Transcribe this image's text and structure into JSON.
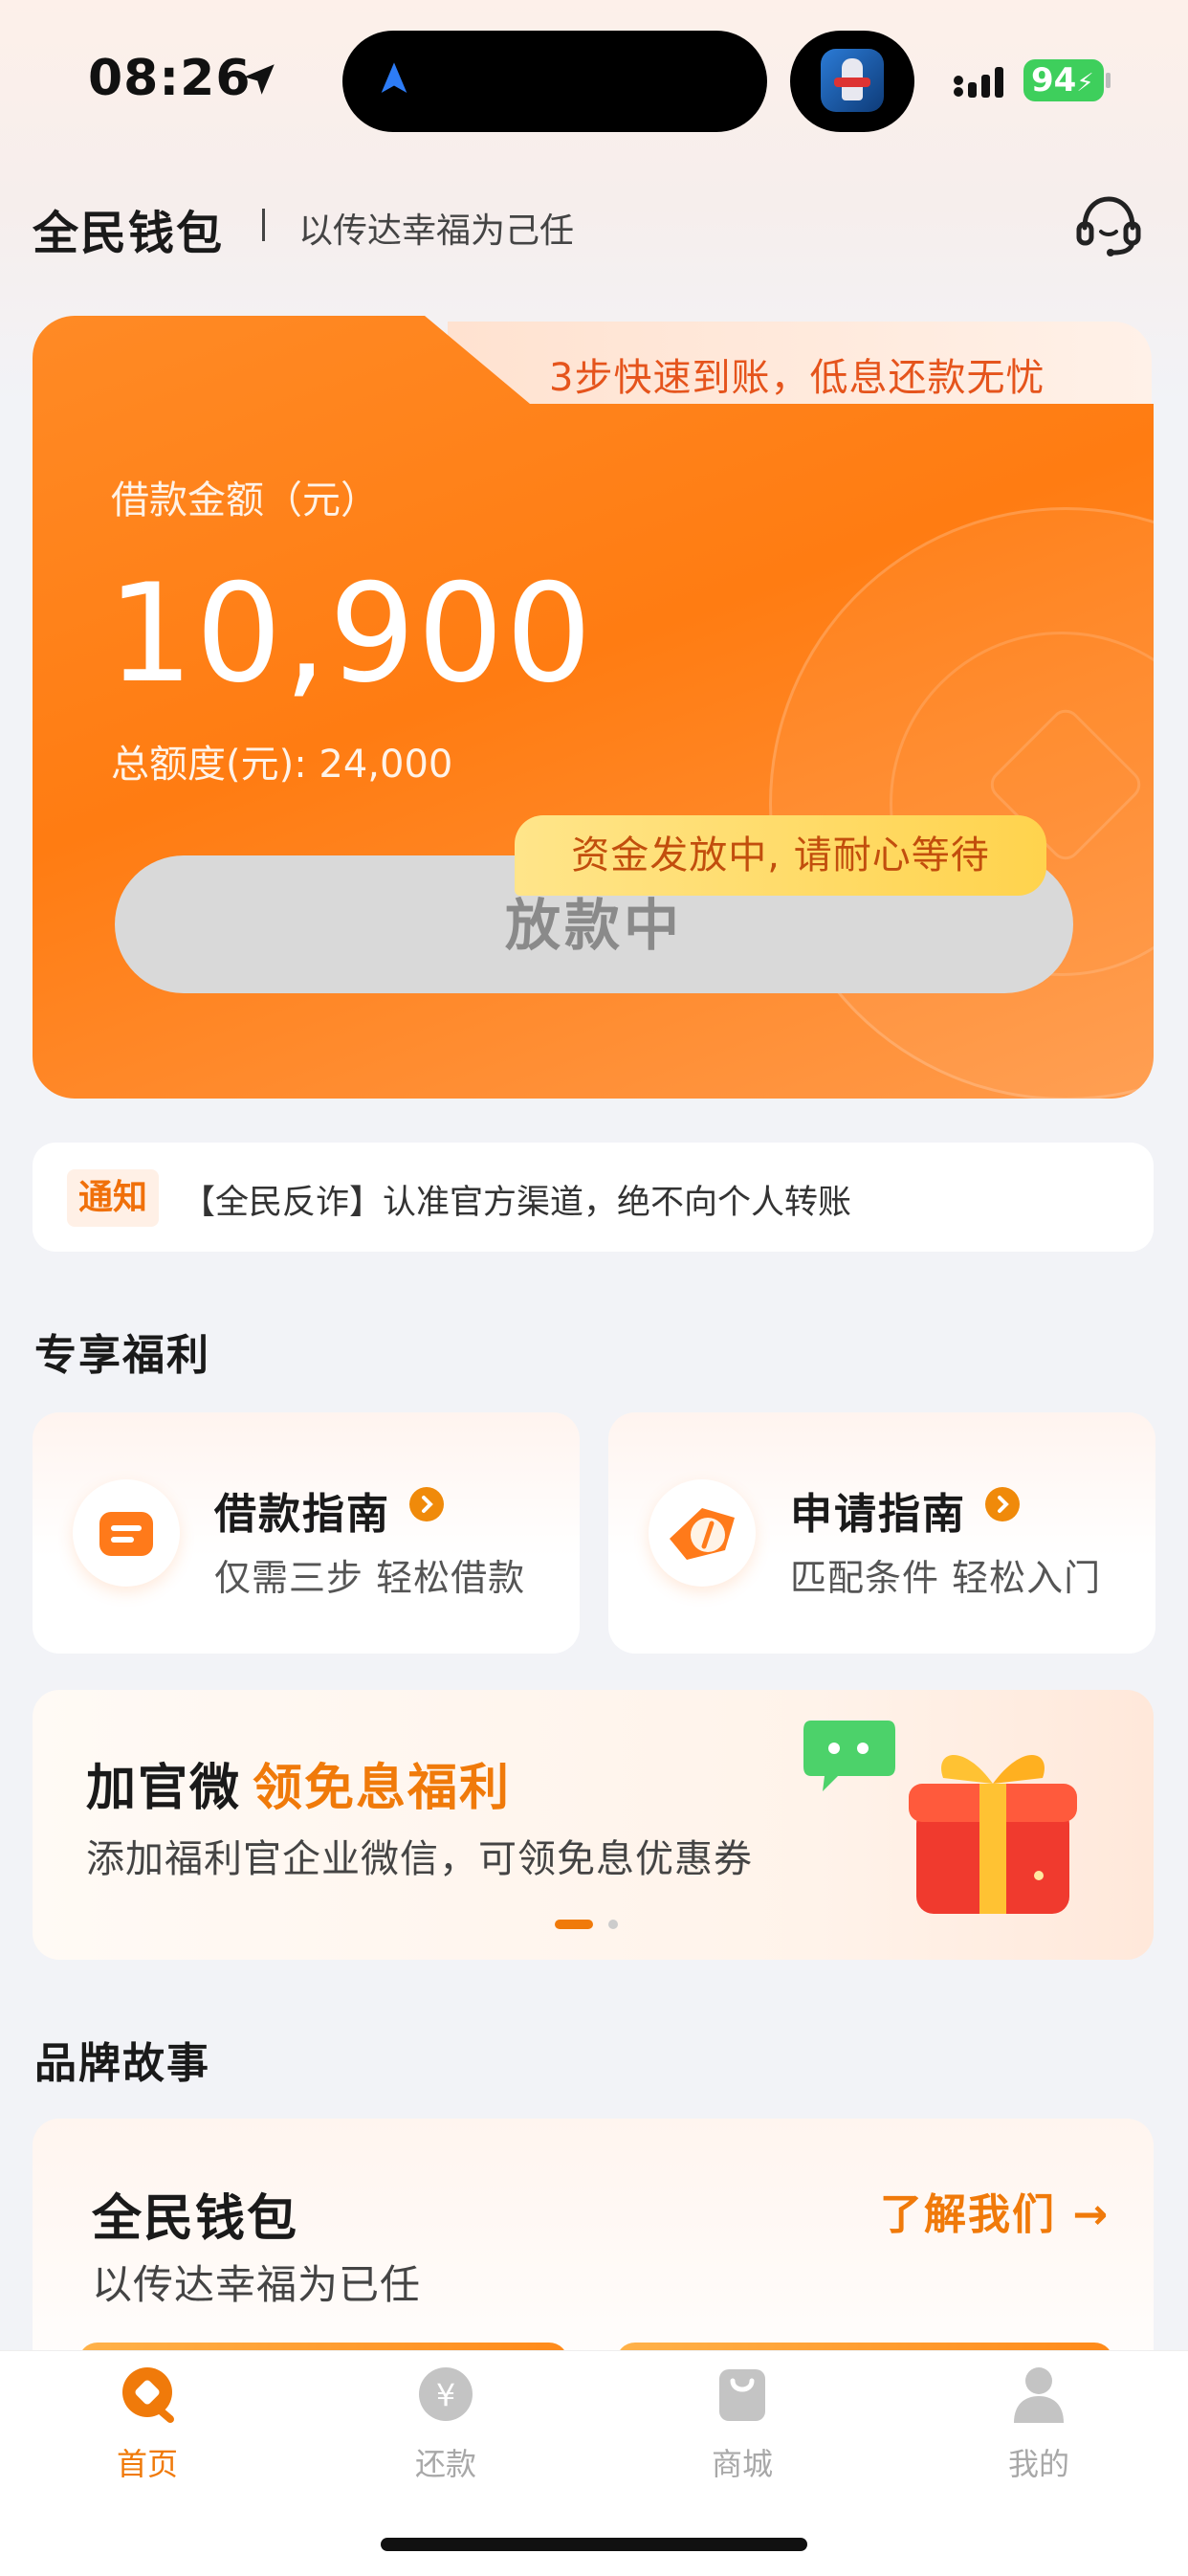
{
  "status_bar": {
    "time": "08:26",
    "battery": "94",
    "icons": [
      "location-arrow-icon",
      "navigation-icon",
      "app-activity-icon",
      "signal-icon",
      "battery-icon"
    ]
  },
  "header": {
    "brand": "全民钱包",
    "slogan": "以传达幸福为己任",
    "support_icon": "headset-icon"
  },
  "loan_card": {
    "tab_text": "3步快速到账，低息还款无忧",
    "amount_label": "借款金额（元）",
    "amount": "10,900",
    "total_quota": "总额度(元): 24,000",
    "button_label": "放款中",
    "tooltip": "资金发放中, 请耐心等待"
  },
  "notice": {
    "tag": "通知",
    "text": "【全民反诈】认准官方渠道，绝不向个人转账"
  },
  "benefits": {
    "title": "专享福利",
    "items": [
      {
        "title": "借款指南",
        "subtitle": "仅需三步 轻松借款",
        "icon": "loan-guide-icon"
      },
      {
        "title": "申请指南",
        "subtitle": "匹配条件 轻松入门",
        "icon": "compass-icon"
      }
    ]
  },
  "banner": {
    "title_black": "加官微",
    "title_orange": "领免息福利",
    "subtitle": "添加福利官企业微信，可领免息优惠券",
    "icons": [
      "wechat-chat-icon",
      "gift-box-icon"
    ]
  },
  "brand_story": {
    "section_title": "品牌故事",
    "title": "全民钱包",
    "subtitle": "以传达幸福为已任",
    "link": "了解我们 →"
  },
  "tabbar": {
    "items": [
      {
        "label": "首页",
        "icon": "home-icon",
        "active": true
      },
      {
        "label": "还款",
        "icon": "yuan-icon",
        "active": false
      },
      {
        "label": "商城",
        "icon": "shopping-bag-icon",
        "active": false
      },
      {
        "label": "我的",
        "icon": "user-icon",
        "active": false
      }
    ]
  },
  "colors": {
    "accent": "#f07a0a",
    "card_orange": "#ff7c12",
    "tooltip_yellow": "#ffd34d",
    "background": "#f2f3f7"
  }
}
